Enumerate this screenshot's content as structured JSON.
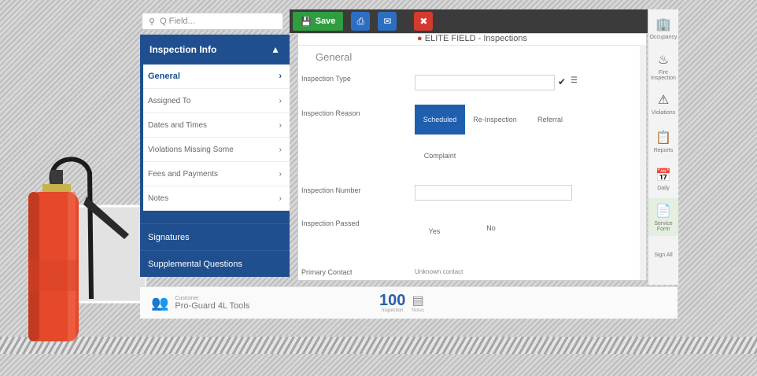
{
  "search": {
    "placeholder": "Q Field..."
  },
  "sidebar": {
    "header": "Inspection Info",
    "items": [
      {
        "label": "General"
      },
      {
        "label": "Assigned To"
      },
      {
        "label": "Dates and Times"
      },
      {
        "label": "Violations Missing Some"
      },
      {
        "label": "Fees and Payments"
      },
      {
        "label": "Notes"
      }
    ],
    "sections": [
      "Signatures",
      "Supplemental Questions"
    ]
  },
  "toolbar": {
    "save_label": "Save"
  },
  "main": {
    "title": "ELITE FIELD - Inspections",
    "section": "General",
    "fields": {
      "inspection_type": "Inspection Type",
      "inspection_reason": "Inspection Reason",
      "reason_options": [
        "Scheduled",
        "Re-Inspection",
        "Referral",
        "Complaint"
      ],
      "inspection_number": "Inspection Number",
      "inspection_passed": "Inspection Passed",
      "passed_options": [
        "Yes",
        "No"
      ],
      "primary_contact": "Primary Contact",
      "primary_contact_value": "Unknown contact"
    }
  },
  "rail": {
    "items": [
      "Occupancy",
      "Fire Inspection",
      "Violations",
      "Reports",
      "Daily",
      "Service Form",
      "Sign All"
    ]
  },
  "footer": {
    "customer_label": "Customer",
    "customer_name": "Pro-Guard 4L Tools",
    "score": "100",
    "score_caption": "Inspection",
    "icon_caption": "Notes"
  },
  "colors": {
    "brand_blue": "#1f4f8f",
    "save_green": "#2e9e3f",
    "close_red": "#d53a2e"
  }
}
